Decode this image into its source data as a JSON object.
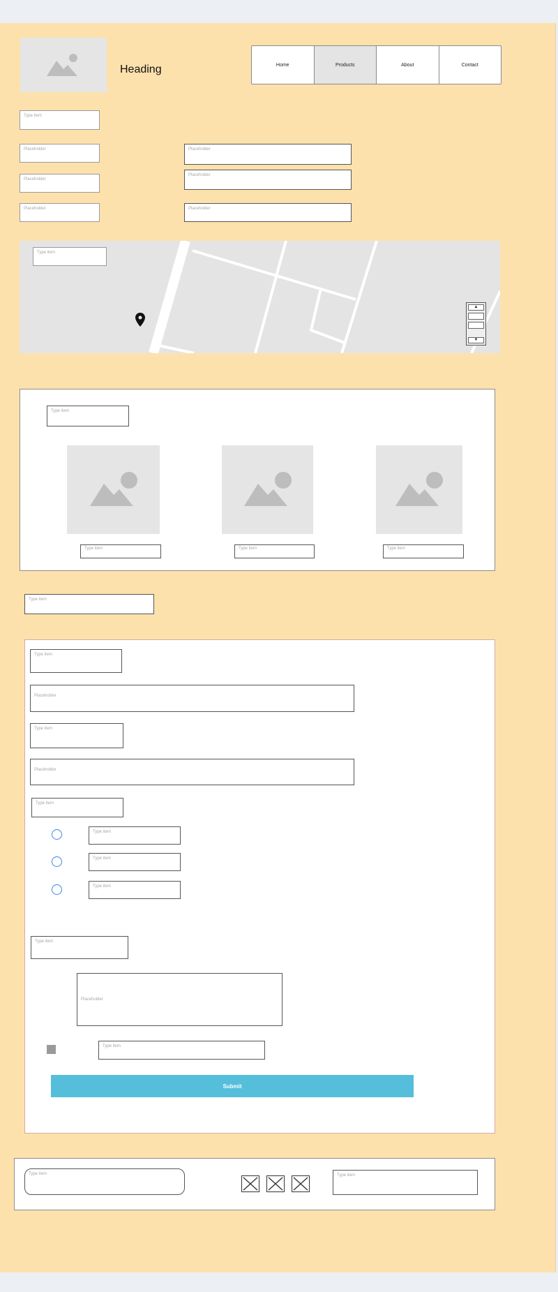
{
  "header": {
    "logo_icon": "image-placeholder-icon",
    "heading": "Heading",
    "nav": [
      {
        "label": "Home",
        "active": false
      },
      {
        "label": "Products",
        "active": true
      },
      {
        "label": "About",
        "active": false
      },
      {
        "label": "Contact",
        "active": false
      }
    ]
  },
  "top_form": {
    "type_item": "Type item",
    "left_placeholders": [
      "Placeholder",
      "Placeholder",
      "Placeholder"
    ],
    "right_placeholders": [
      "Placeholder",
      "Placeholder",
      "Placeholder"
    ]
  },
  "map": {
    "search_label": "Type item",
    "pin_icon": "map-pin-icon",
    "zoom_in": "▲",
    "zoom_out": "▼"
  },
  "gallery": {
    "title": "Type item",
    "items": [
      {
        "caption": "Type item"
      },
      {
        "caption": "Type item"
      },
      {
        "caption": "Type item"
      }
    ]
  },
  "section_label": "Type item",
  "form": {
    "label1": "Type item",
    "input1": "Placeholder",
    "label2": "Type item",
    "input2": "Placeholder",
    "radio_group_label": "Type item",
    "radio_options": [
      "Type item",
      "Type item",
      "Type item"
    ],
    "textarea_label": "Type item",
    "textarea_placeholder": "Placeholder",
    "checkbox_label": "Type item",
    "submit": "Submit"
  },
  "footer": {
    "search": "Type item",
    "social_icons": [
      "social-icon-1",
      "social-icon-2",
      "social-icon-3"
    ],
    "right_field": "Type item"
  },
  "colors": {
    "canvas": "#fde1ac",
    "button": "#54bedb",
    "radio": "#3a86e0"
  }
}
